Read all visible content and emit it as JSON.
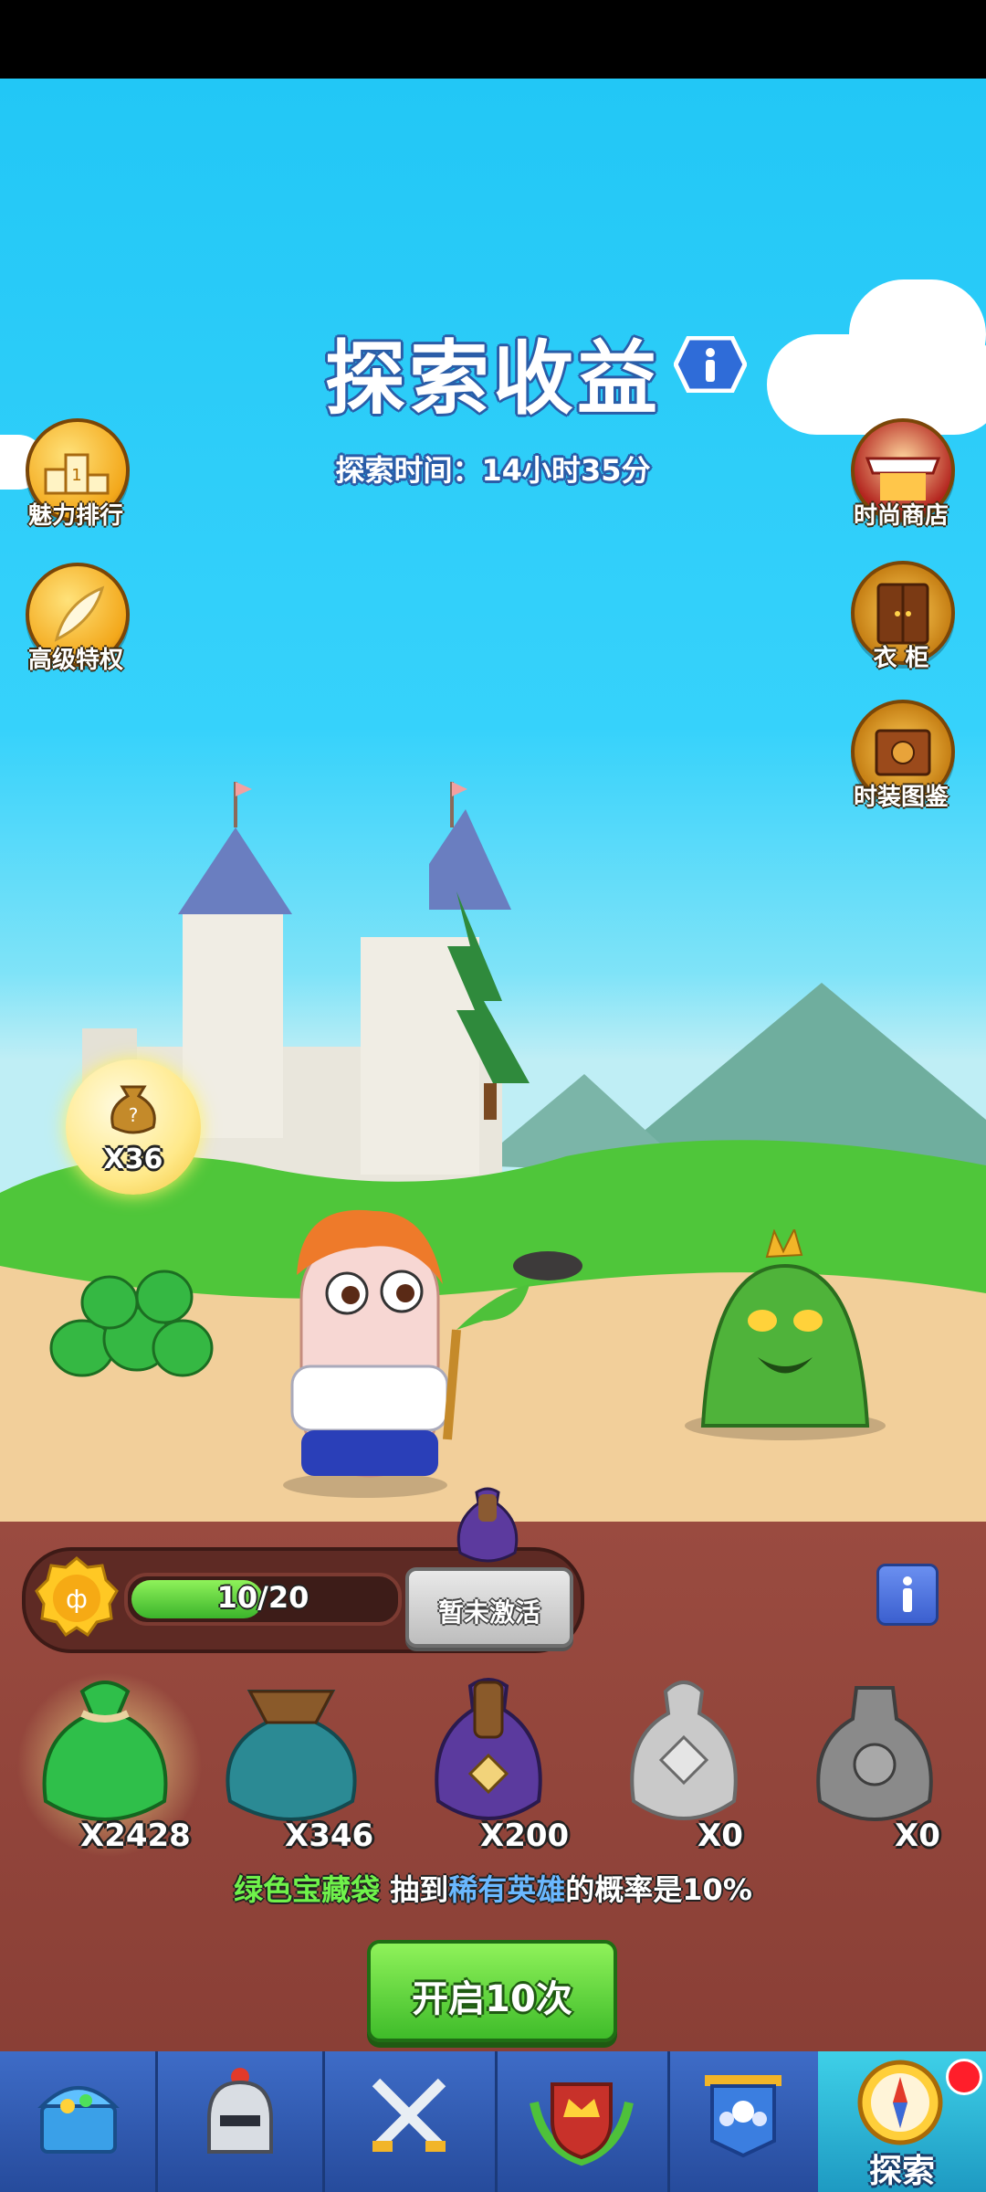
{
  "header": {
    "title": "探索收益",
    "explore_time_label": "探索时间：",
    "explore_time_value": "14小时35分"
  },
  "side_buttons_left": [
    {
      "label": "魅力排行",
      "icon": "ranking-podium-icon"
    },
    {
      "label": "高级特权",
      "icon": "feather-privilege-icon"
    }
  ],
  "side_buttons_right": [
    {
      "label": "时尚商店",
      "icon": "shop-awning-icon"
    },
    {
      "label": "衣 柜",
      "icon": "wardrobe-icon"
    },
    {
      "label": "时装图鉴",
      "icon": "book-icon"
    }
  ],
  "loot_bubble": {
    "count": "X36"
  },
  "progress": {
    "text": "10/20",
    "current": 10,
    "max": 20,
    "status_button": "暂未激活"
  },
  "bags": [
    {
      "name": "green-bag",
      "count": "X2428",
      "color": "#2fbf4a"
    },
    {
      "name": "teal-bag",
      "count": "X346",
      "color": "#2b8a94"
    },
    {
      "name": "purple-bag",
      "count": "X200",
      "color": "#5b3a9e"
    },
    {
      "name": "silver-bag",
      "count": "X0",
      "color": "#bdbdbd"
    },
    {
      "name": "dark-gray-bag",
      "count": "X0",
      "color": "#7a7a7a"
    }
  ],
  "description": {
    "bag": "绿色宝藏袋",
    "mid": "抽到",
    "rare": "稀有英雄",
    "tail": "的概率是10%"
  },
  "open_button": "开启10次",
  "nav": [
    {
      "icon": "treasure-chest-icon",
      "label": ""
    },
    {
      "icon": "knight-helmet-icon",
      "label": ""
    },
    {
      "icon": "crossed-swords-icon",
      "label": ""
    },
    {
      "icon": "crown-shield-icon",
      "label": ""
    },
    {
      "icon": "guild-banner-icon",
      "label": ""
    },
    {
      "icon": "compass-icon",
      "label": "探索"
    }
  ],
  "colors": {
    "sky": "#22c7f6",
    "panel": "#8f433a",
    "nav": "#3357b0",
    "accent_green": "#5cd32f"
  }
}
